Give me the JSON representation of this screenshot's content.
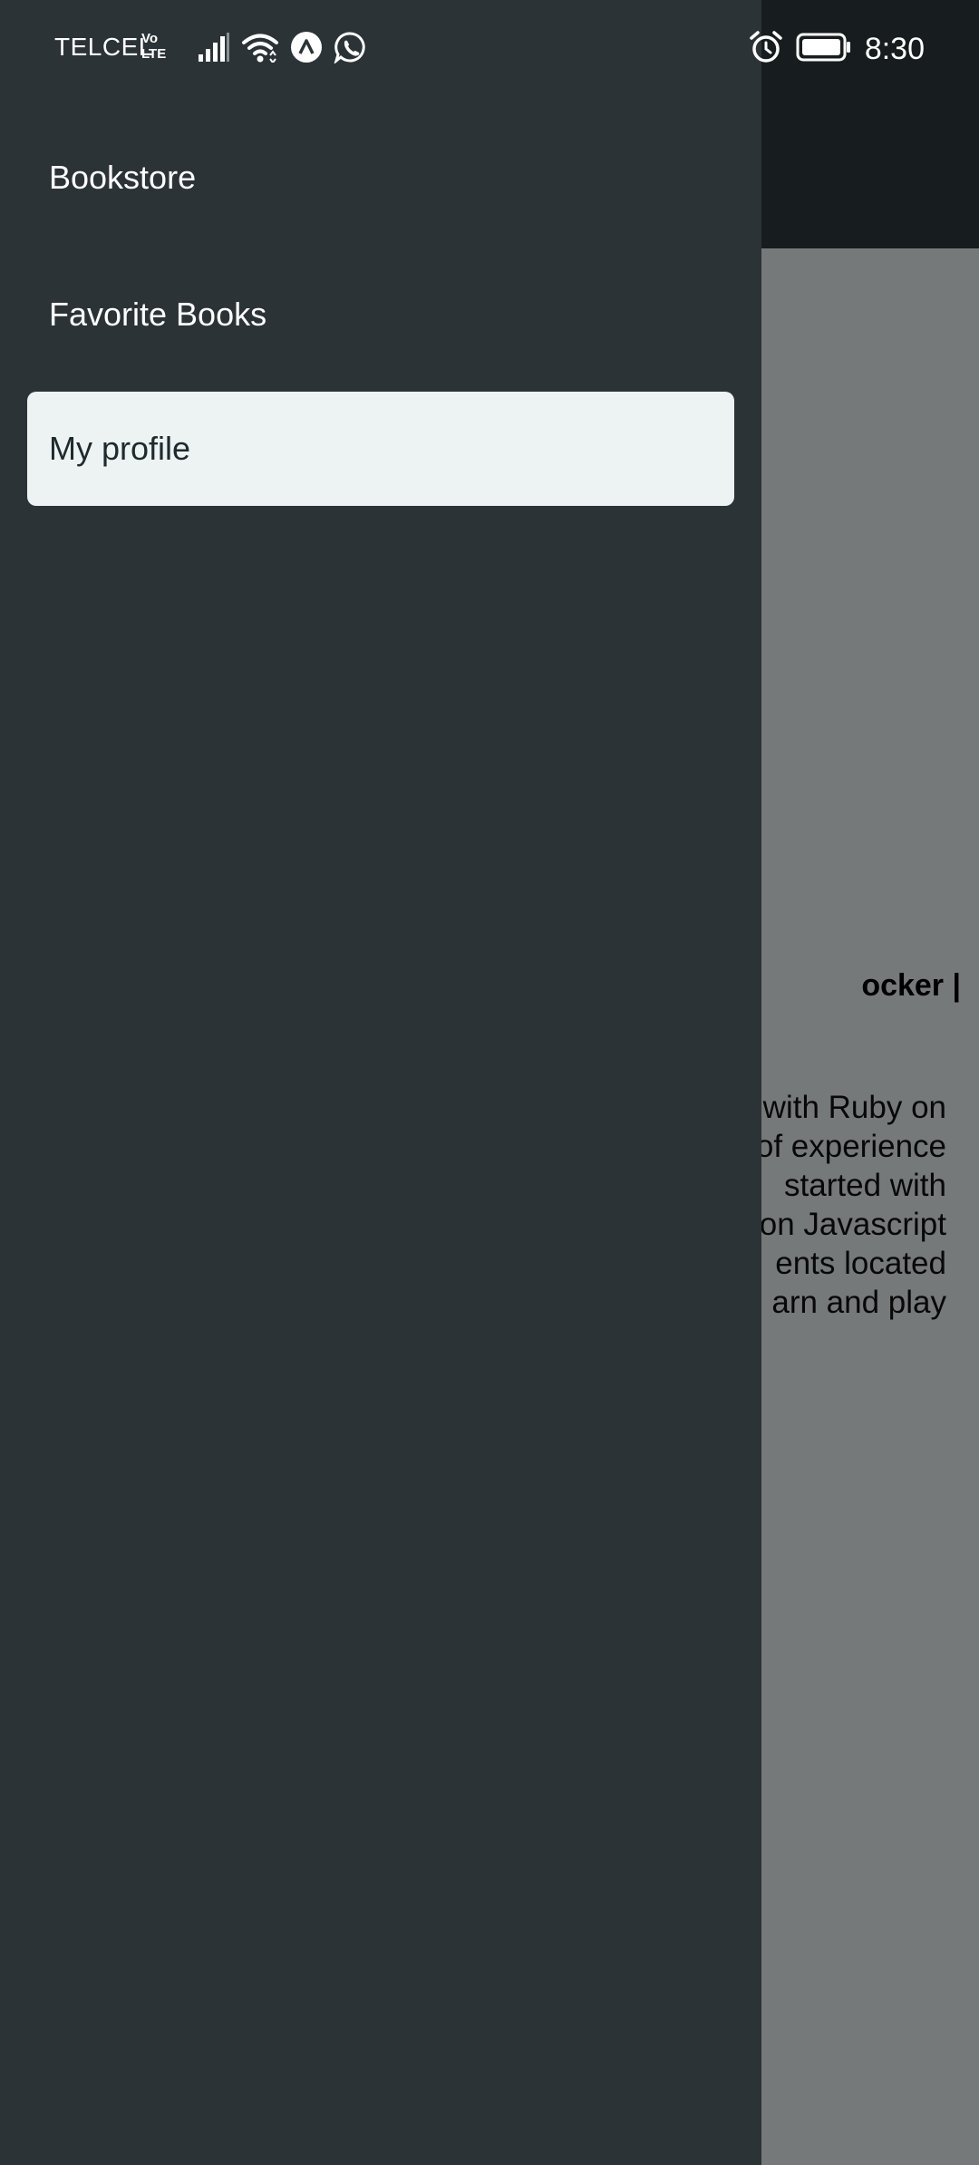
{
  "status_bar": {
    "carrier": "TELCEL",
    "volte_top": "Vo",
    "volte_bottom": "LTE",
    "time": "8:30",
    "icons": [
      "signal-icon",
      "wifi-icon",
      "app-icon",
      "whatsapp-icon",
      "alarm-icon",
      "battery-icon"
    ]
  },
  "drawer": {
    "items": [
      {
        "label": "Bookstore",
        "active": false
      },
      {
        "label": "Favorite Books",
        "active": false
      },
      {
        "label": "My profile",
        "active": true
      }
    ]
  },
  "background": {
    "profile_title_fragment": "ocker |",
    "bio_lines": [
      "with Ruby on",
      "of experience",
      "started with",
      "on Javascript",
      "ents located",
      "arn and play"
    ]
  },
  "colors": {
    "drawer_bg": "#2c3337",
    "active_item_bg": "#edf3f3",
    "scrim": "rgba(0,0,0,0.5)"
  }
}
